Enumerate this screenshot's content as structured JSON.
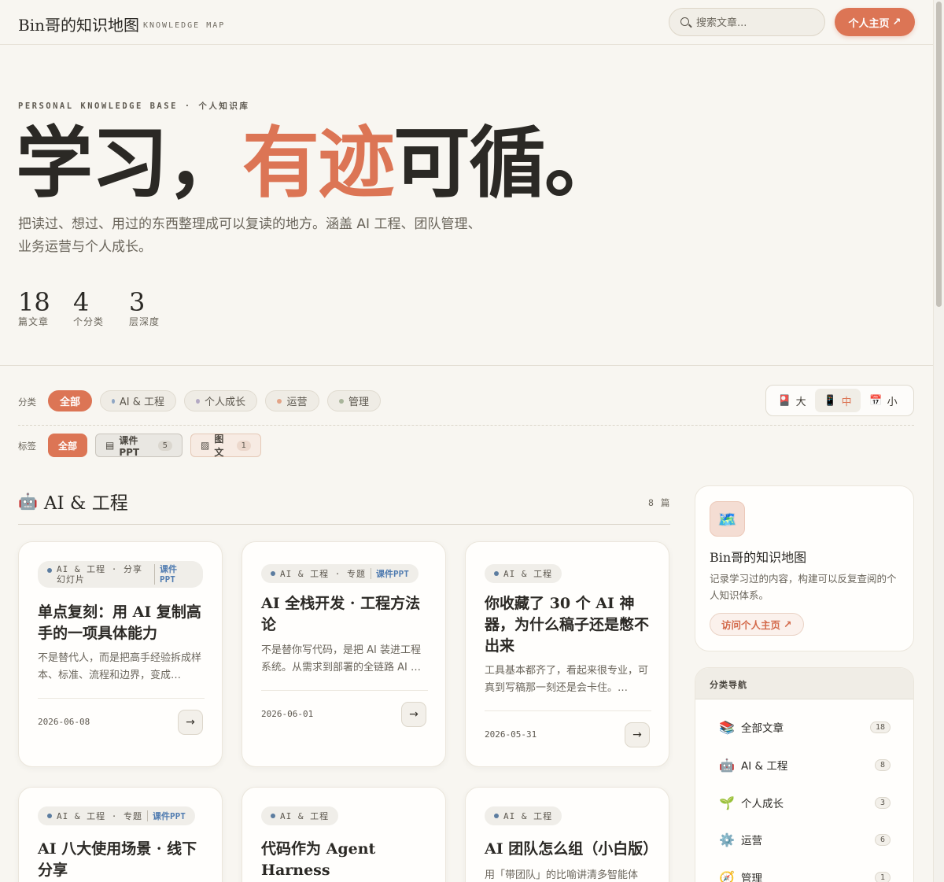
{
  "header": {
    "brand": "Bin哥的知识地图",
    "brand_sub": "KNOWLEDGE MAP",
    "search_placeholder": "搜索文章...",
    "home_label": "个人主页",
    "home_icon": "arrow-up-right-icon"
  },
  "hero": {
    "eyebrow": "PERSONAL KNOWLEDGE BASE · 个人知识库",
    "title_part1": "学习，",
    "title_accent": "有迹",
    "title_part2": "可循。",
    "description": "把读过、想过、用过的东西整理成可以复读的地方。涵盖 AI 工程、团队管理、业务运营与个人成长。",
    "stats": [
      {
        "num": "18",
        "label": "篇文章"
      },
      {
        "num": "4",
        "label": "个分类"
      },
      {
        "num": "3",
        "label": "层深度"
      }
    ]
  },
  "filters": {
    "category_label": "分类",
    "categories": [
      {
        "label": "全部",
        "active": true
      },
      {
        "label": "AI & 工程",
        "color": "#8fa6c4"
      },
      {
        "label": "个人成长",
        "color": "#b3a9c3"
      },
      {
        "label": "运营",
        "color": "#e3a487"
      },
      {
        "label": "管理",
        "color": "#a9b59b"
      }
    ],
    "tag_label": "标签",
    "tags": [
      {
        "label": "全部"
      },
      {
        "label": "课件PPT",
        "count": "5"
      },
      {
        "label": "图文",
        "count": "1"
      }
    ],
    "sizes": [
      {
        "label": "大",
        "icon": "🎴"
      },
      {
        "label": "中",
        "icon": "📱"
      },
      {
        "label": "小",
        "icon": "📅"
      }
    ]
  },
  "section": {
    "icon": "🤖",
    "title": "AI & 工程",
    "count": "8 篇"
  },
  "cards": [
    {
      "meta": "AI & 工程 · 分享幻灯片",
      "kind": "课件PPT",
      "title": "单点复刻：用 AI 复制高手的一项具体能力",
      "desc": "不是替代人，而是把高手经验拆成样本、标准、流程和边界，变成…",
      "date": "2026-06-08"
    },
    {
      "meta": "AI & 工程 · 专题",
      "kind": "课件PPT",
      "title": "AI 全栈开发 · 工程方法论",
      "desc": "不是替你写代码，是把 AI 装进工程系统。从需求到部署的全链路 AI …",
      "date": "2026-06-01"
    },
    {
      "meta": "AI & 工程",
      "kind": "",
      "title": "你收藏了 30 个 AI 神器，为什么稿子还是憋不出来",
      "desc": "工具基本都齐了，看起来很专业，可真到写稿那一刻还是会卡住。…",
      "date": "2026-05-31"
    },
    {
      "meta": "AI & 工程 · 专题",
      "kind": "课件PPT",
      "title": "AI 八大使用场景 · 线下分享",
      "desc": "",
      "date": ""
    },
    {
      "meta": "AI & 工程",
      "kind": "",
      "title": "代码作为 Agent Harness",
      "desc": "",
      "date": ""
    },
    {
      "meta": "AI & 工程",
      "kind": "",
      "title": "AI 团队怎么组（小白版）",
      "desc": "用「带团队」的比喻讲清多智能体",
      "date": ""
    }
  ],
  "profile": {
    "avatar_icon": "🗺️",
    "name": "Bin哥的知识地图",
    "desc": "记录学习过的内容，构建可以反复查阅的个人知识体系。",
    "link_label": "访问个人主页"
  },
  "nav": {
    "title": "分类导航",
    "items": [
      {
        "icon": "📚",
        "label": "全部文章",
        "count": "18"
      },
      {
        "icon": "🤖",
        "label": "AI & 工程",
        "count": "8"
      },
      {
        "icon": "🌱",
        "label": "个人成长",
        "count": "3"
      },
      {
        "icon": "⚙️",
        "label": "运营",
        "count": "6"
      },
      {
        "icon": "🧭",
        "label": "管理",
        "count": "1"
      }
    ]
  }
}
